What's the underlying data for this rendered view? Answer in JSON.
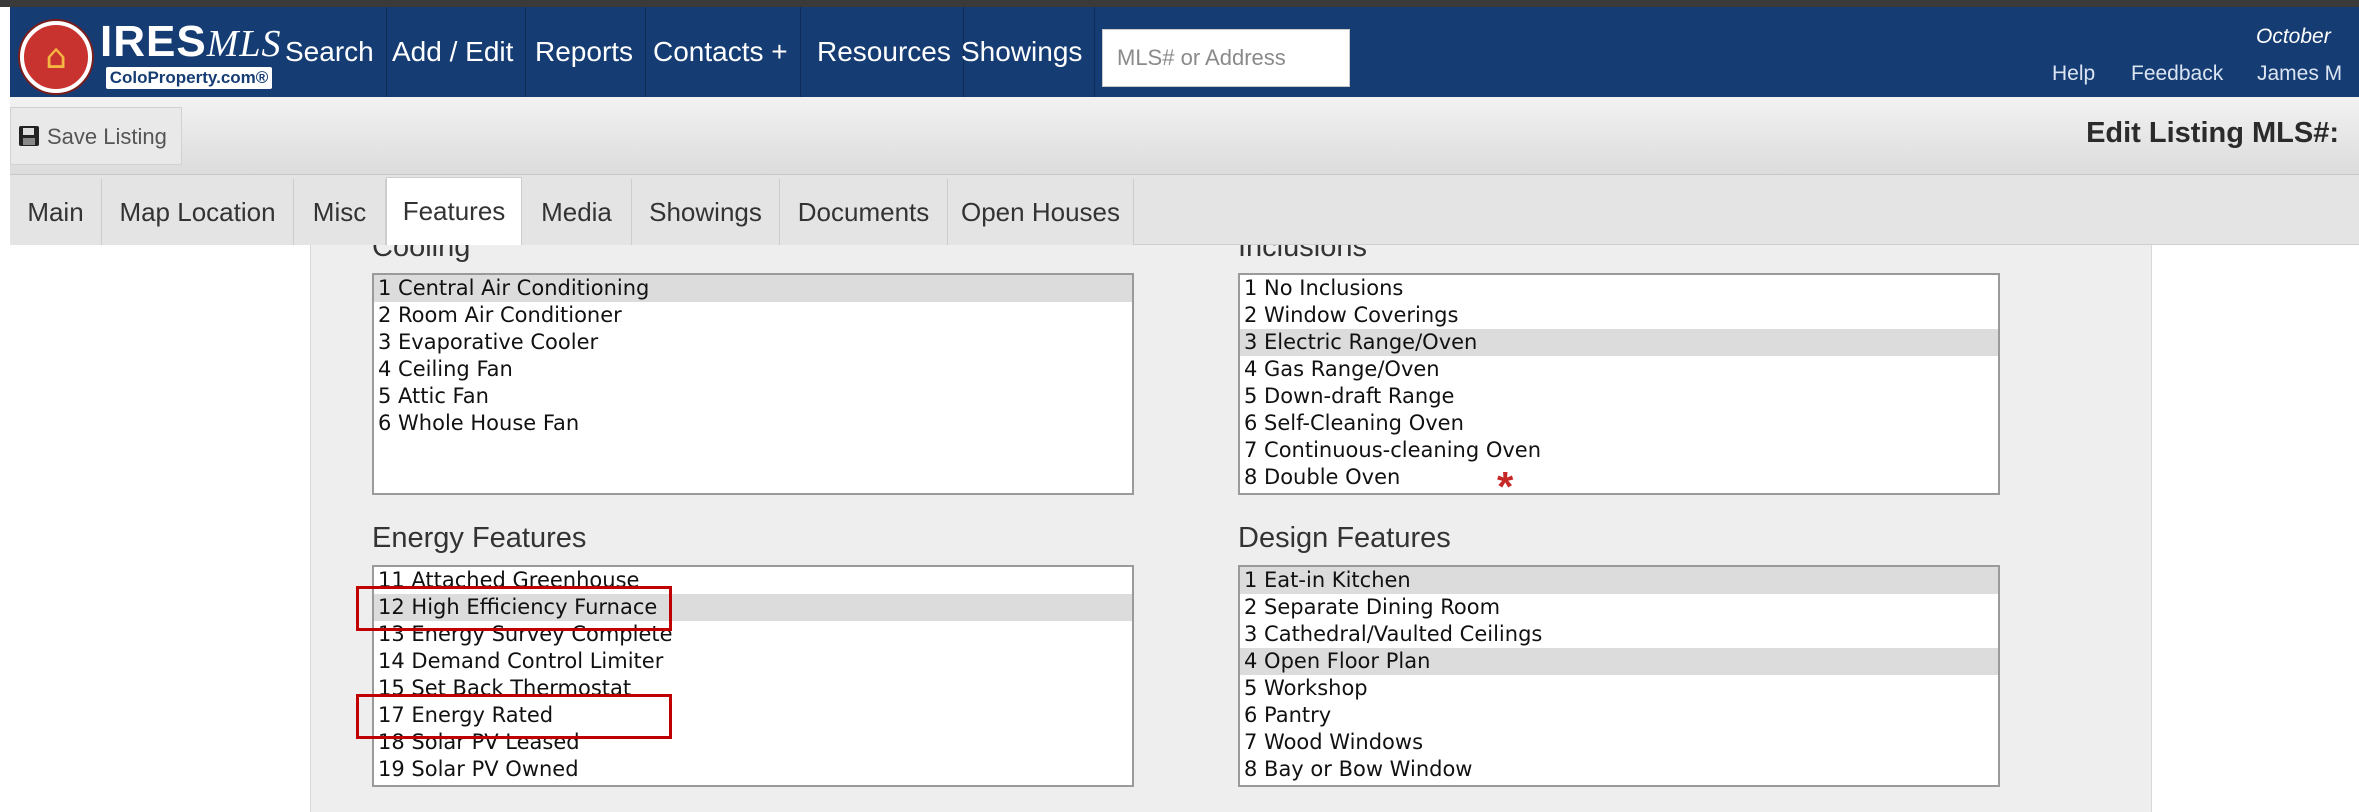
{
  "nav": {
    "logo_text": "IRES",
    "logo_script": "MLS",
    "logo_sub": "ColoProperty.com®",
    "items": [
      "Search",
      "Add / Edit",
      "Reports",
      "Contacts +",
      "Resources",
      "Showings"
    ],
    "search_placeholder": "MLS# or Address",
    "date": "October",
    "help": "Help",
    "feedback": "Feedback",
    "user": "James M"
  },
  "toolbar": {
    "save_label": "Save Listing",
    "edit_title": "Edit Listing MLS#:"
  },
  "tabs": [
    {
      "label": "Main",
      "active": false
    },
    {
      "label": "Map Location",
      "active": false
    },
    {
      "label": "Misc",
      "active": false
    },
    {
      "label": "Features",
      "active": true
    },
    {
      "label": "Media",
      "active": false
    },
    {
      "label": "Showings",
      "active": false
    },
    {
      "label": "Documents",
      "active": false
    },
    {
      "label": "Open Houses",
      "active": false
    }
  ],
  "cooling": {
    "title": "Cooling",
    "options": [
      {
        "label": "1 Central Air Conditioning",
        "selected": true
      },
      {
        "label": "2 Room Air Conditioner",
        "selected": false
      },
      {
        "label": "3 Evaporative Cooler",
        "selected": false
      },
      {
        "label": "4 Ceiling Fan",
        "selected": false
      },
      {
        "label": "5 Attic Fan",
        "selected": false
      },
      {
        "label": "6 Whole House Fan",
        "selected": false
      }
    ]
  },
  "inclusions": {
    "title": "Inclusions",
    "options": [
      {
        "label": "1 No Inclusions",
        "selected": false
      },
      {
        "label": "2 Window Coverings",
        "selected": false
      },
      {
        "label": "3 Electric Range/Oven",
        "selected": true
      },
      {
        "label": "4 Gas Range/Oven",
        "selected": false
      },
      {
        "label": "5 Down-draft Range",
        "selected": false
      },
      {
        "label": "6 Self-Cleaning Oven",
        "selected": false
      },
      {
        "label": "7 Continuous-cleaning Oven",
        "selected": false
      },
      {
        "label": "8 Double Oven",
        "selected": false
      }
    ]
  },
  "energy": {
    "title": "Energy Features",
    "options": [
      {
        "label": "11 Attached Greenhouse",
        "selected": false
      },
      {
        "label": "12 High Efficiency Furnace",
        "selected": true
      },
      {
        "label": "13 Energy Survey Complete",
        "selected": false
      },
      {
        "label": "14 Demand Control Limiter",
        "selected": false
      },
      {
        "label": "15 Set Back Thermostat",
        "selected": false
      },
      {
        "label": "17 Energy Rated",
        "selected": false
      },
      {
        "label": "18 Solar PV Leased",
        "selected": false
      },
      {
        "label": "19 Solar PV Owned",
        "selected": false
      }
    ]
  },
  "design": {
    "title": "Design Features",
    "options": [
      {
        "label": "1 Eat-in Kitchen",
        "selected": true
      },
      {
        "label": "2 Separate Dining Room",
        "selected": false
      },
      {
        "label": "3 Cathedral/Vaulted Ceilings",
        "selected": false
      },
      {
        "label": "4 Open Floor Plan",
        "selected": true
      },
      {
        "label": "5 Workshop",
        "selected": false
      },
      {
        "label": "6 Pantry",
        "selected": false
      },
      {
        "label": "7 Wood Windows",
        "selected": false
      },
      {
        "label": "8 Bay or Bow Window",
        "selected": false
      }
    ]
  },
  "required_marker": "*"
}
